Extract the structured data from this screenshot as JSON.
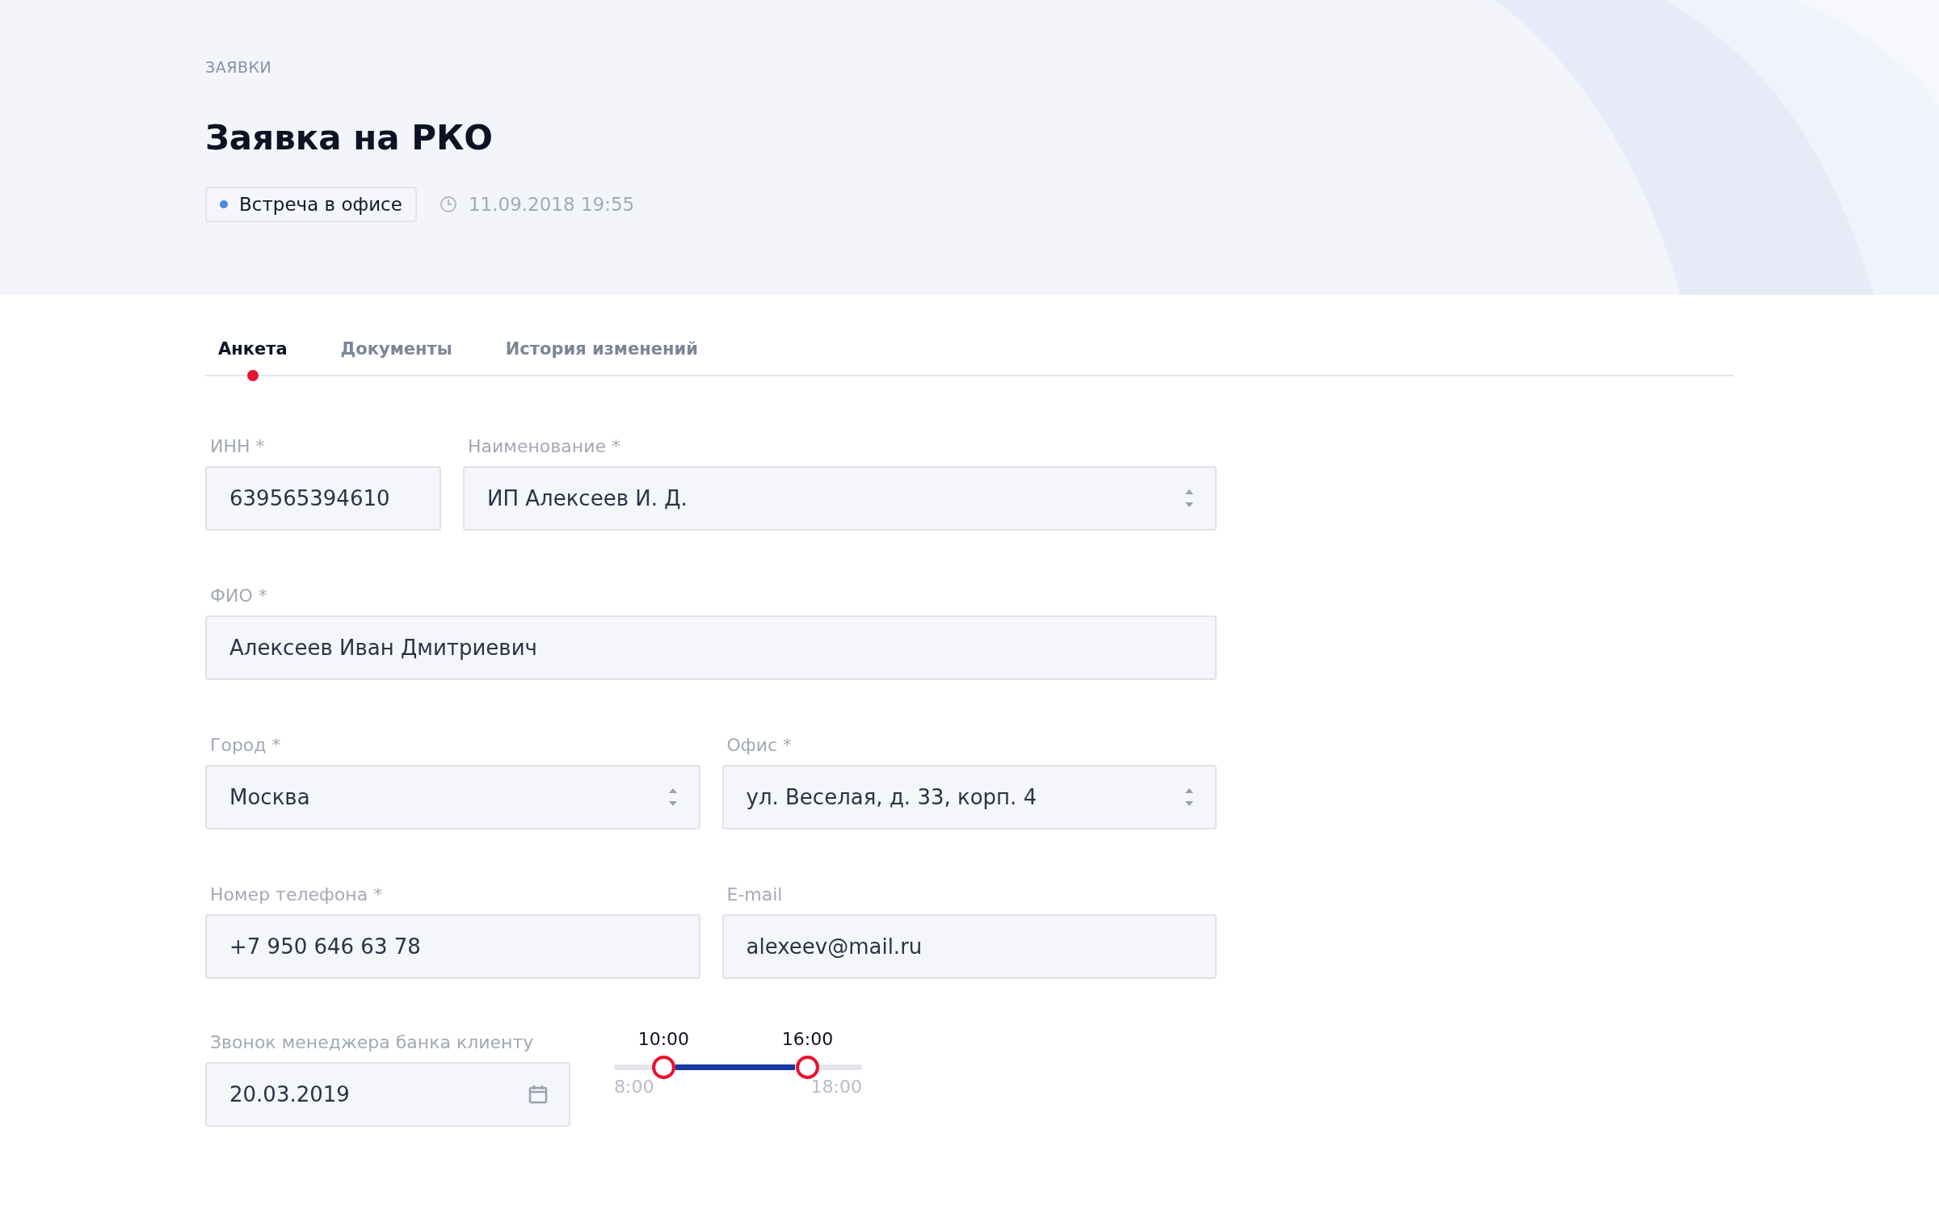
{
  "header": {
    "breadcrumb": "ЗАЯВКИ",
    "title": "Заявка на РКО",
    "status": {
      "label": "Встреча в офисе",
      "color": "#4a88e0"
    },
    "datetime": "11.09.2018 19:55"
  },
  "tabs": [
    {
      "label": "Анкета",
      "selected": true
    },
    {
      "label": "Документы",
      "selected": false
    },
    {
      "label": "История изменений",
      "selected": false
    }
  ],
  "form": {
    "rows": [
      [
        {
          "label": "ИНН *",
          "kind": "text",
          "value": "639565394610"
        },
        {
          "label": "Наименование *",
          "kind": "select",
          "value": "ИП Алексеев И. Д."
        }
      ],
      [
        {
          "label": "ФИО *",
          "kind": "text",
          "value": "Алексеев Иван Дмитриевич"
        }
      ],
      [
        {
          "label": "Город *",
          "kind": "select",
          "value": "Москва"
        },
        {
          "label": "Офис *",
          "kind": "select",
          "value": "ул. Веселая, д. 33, корп. 4"
        }
      ],
      [
        {
          "label": "Номер телефона *",
          "kind": "text",
          "value": "+7 950 646 63 78"
        },
        {
          "label": "E-mail",
          "kind": "text",
          "value": "alexeev@mail.ru"
        }
      ]
    ],
    "call": {
      "label": "Звонок менеджера банка клиенту",
      "date": "20.03.2019",
      "slider": {
        "min_label": "8:00",
        "max_label": "18:00",
        "thumbs": [
          {
            "label": "10:00",
            "level": 0.2
          },
          {
            "label": "16:00",
            "level": 0.78
          }
        ]
      }
    }
  }
}
